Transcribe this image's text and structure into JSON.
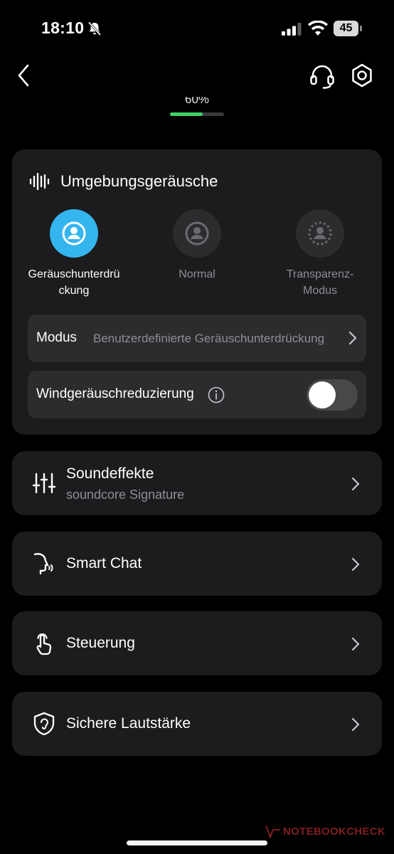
{
  "status_bar": {
    "time": "18:10",
    "battery_level": "45",
    "icons": [
      "bell-slash-icon",
      "signal-icon",
      "wifi-icon",
      "battery-icon"
    ]
  },
  "header": {
    "icons": [
      "back-chevron-icon",
      "headset-icon",
      "gear-icon"
    ],
    "battery_percent": "60%",
    "battery_fraction": 0.6,
    "battery_color": "#3dd267"
  },
  "ambient": {
    "title": "Umgebungsgeräusche",
    "icon": "sound-wave-icon",
    "modes": [
      {
        "label": "Geräuschunterdrü\nckung",
        "icon": "noise-cancel-icon",
        "active": true
      },
      {
        "label": "Normal",
        "icon": "normal-mode-icon",
        "active": false
      },
      {
        "label": "Transparenz-\nModus",
        "icon": "transparency-icon",
        "active": false
      }
    ],
    "accent_color": "#35b5ee",
    "modus_label": "Modus",
    "modus_value": "Benutzerdefinierte Geräuschunterdrückung",
    "wind_label": "Windgeräuschreduzierung",
    "wind_enabled": false
  },
  "nav_items": [
    {
      "title": "Soundeffekte",
      "subtitle": "soundcore Signature",
      "icon": "equalizer-sliders-icon"
    },
    {
      "title": "Smart Chat",
      "icon": "speaking-head-icon"
    },
    {
      "title": "Steuerung",
      "icon": "touch-hand-icon"
    },
    {
      "title": "Sichere Lautstärke",
      "icon": "ear-shield-icon"
    }
  ],
  "watermark": "NOTEBOOKCHECK"
}
